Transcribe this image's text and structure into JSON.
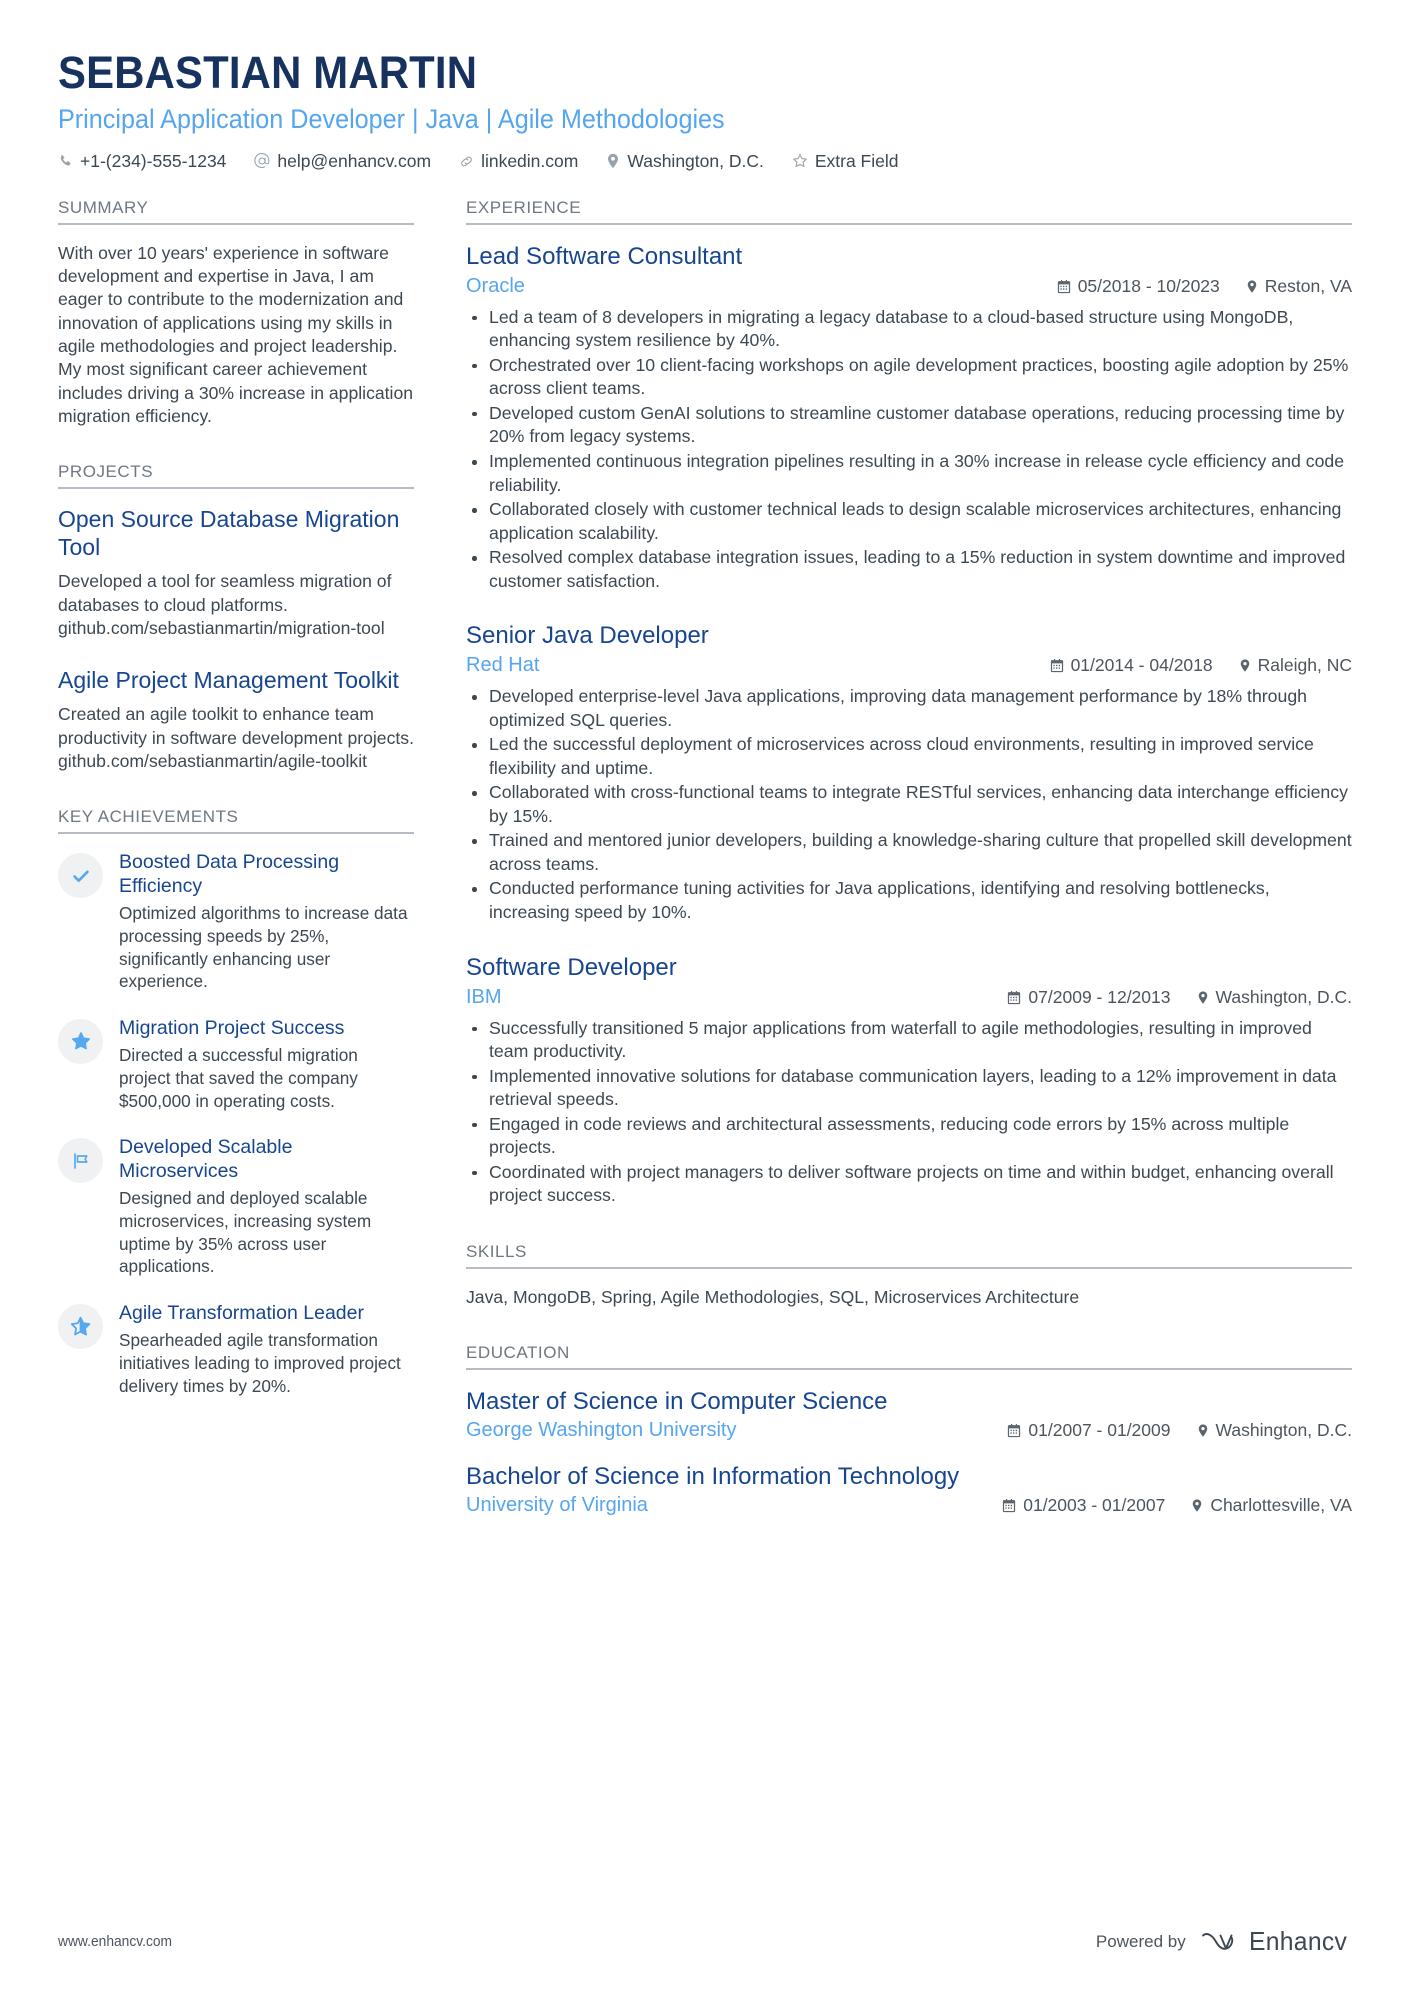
{
  "header": {
    "name": "SEBASTIAN MARTIN",
    "title": "Principal Application Developer | Java | Agile Methodologies",
    "contacts": [
      {
        "icon": "phone-icon",
        "text": "+1-(234)-555-1234"
      },
      {
        "icon": "at-icon",
        "text": "help@enhancv.com"
      },
      {
        "icon": "link-icon",
        "text": "linkedin.com"
      },
      {
        "icon": "location-pin-icon",
        "text": "Washington, D.C."
      },
      {
        "icon": "star-outline-icon",
        "text": "Extra Field"
      }
    ]
  },
  "sidebar": {
    "summary": {
      "heading": "SUMMARY",
      "text": "With over 10 years' experience in software development and expertise in Java, I am eager to contribute to the modernization and innovation of applications using my skills in agile methodologies and project leadership. My most significant career achievement includes driving a 30% increase in application migration efficiency."
    },
    "projects": {
      "heading": "PROJECTS",
      "items": [
        {
          "title": "Open Source Database Migration Tool",
          "description": "Developed a tool for seamless migration of databases to cloud platforms.\ngithub.com/sebastianmartin/migration-tool"
        },
        {
          "title": "Agile Project Management Toolkit",
          "description": "Created an agile toolkit to enhance team productivity in software development projects.\ngithub.com/sebastianmartin/agile-toolkit"
        }
      ]
    },
    "achievements": {
      "heading": "KEY ACHIEVEMENTS",
      "items": [
        {
          "icon": "check-icon",
          "title": "Boosted Data Processing Efficiency",
          "description": "Optimized algorithms to increase data processing speeds by 25%, significantly enhancing user experience."
        },
        {
          "icon": "star-filled-icon",
          "title": "Migration Project Success",
          "description": "Directed a successful migration project that saved the company $500,000 in operating costs."
        },
        {
          "icon": "flag-icon",
          "title": "Developed Scalable Microservices",
          "description": "Designed and deployed scalable microservices, increasing system uptime by 35% across user applications."
        },
        {
          "icon": "star-half-icon",
          "title": "Agile Transformation Leader",
          "description": "Spearheaded agile transformation initiatives leading to improved project delivery times by 20%."
        }
      ]
    }
  },
  "main": {
    "experience": {
      "heading": "EXPERIENCE",
      "jobs": [
        {
          "title": "Lead Software Consultant",
          "company": "Oracle",
          "dates": "05/2018 - 10/2023",
          "location": "Reston, VA",
          "bullets": [
            "Led a team of 8 developers in migrating a legacy database to a cloud-based structure using MongoDB, enhancing system resilience by 40%.",
            "Orchestrated over 10 client-facing workshops on agile development practices, boosting agile adoption by 25% across client teams.",
            "Developed custom GenAI solutions to streamline customer database operations, reducing processing time by 20% from legacy systems.",
            "Implemented continuous integration pipelines resulting in a 30% increase in release cycle efficiency and code reliability.",
            "Collaborated closely with customer technical leads to design scalable microservices architectures, enhancing application scalability.",
            "Resolved complex database integration issues, leading to a 15% reduction in system downtime and improved customer satisfaction."
          ]
        },
        {
          "title": "Senior Java Developer",
          "company": "Red Hat",
          "dates": "01/2014 - 04/2018",
          "location": "Raleigh, NC",
          "bullets": [
            "Developed enterprise-level Java applications, improving data management performance by 18% through optimized SQL queries.",
            "Led the successful deployment of microservices across cloud environments, resulting in improved service flexibility and uptime.",
            "Collaborated with cross-functional teams to integrate RESTful services, enhancing data interchange efficiency by 15%.",
            "Trained and mentored junior developers, building a knowledge-sharing culture that propelled skill development across teams.",
            "Conducted performance tuning activities for Java applications, identifying and resolving bottlenecks, increasing speed by 10%."
          ]
        },
        {
          "title": "Software Developer",
          "company": "IBM",
          "dates": "07/2009 - 12/2013",
          "location": "Washington, D.C.",
          "bullets": [
            "Successfully transitioned 5 major applications from waterfall to agile methodologies, resulting in improved team productivity.",
            "Implemented innovative solutions for database communication layers, leading to a 12% improvement in data retrieval speeds.",
            "Engaged in code reviews and architectural assessments, reducing code errors by 15% across multiple projects.",
            "Coordinated with project managers to deliver software projects on time and within budget, enhancing overall project success."
          ]
        }
      ]
    },
    "skills": {
      "heading": "SKILLS",
      "text": "Java, MongoDB, Spring, Agile Methodologies, SQL, Microservices Architecture"
    },
    "education": {
      "heading": "EDUCATION",
      "items": [
        {
          "degree": "Master of Science in Computer Science",
          "school": "George Washington University",
          "dates": "01/2007 - 01/2009",
          "location": "Washington, D.C."
        },
        {
          "degree": "Bachelor of Science in Information Technology",
          "school": "University of Virginia",
          "dates": "01/2003 - 01/2007",
          "location": "Charlottesville, VA"
        }
      ]
    }
  },
  "footer": {
    "url": "www.enhancv.com",
    "powered_by": "Powered by",
    "brand": "Enhancv"
  },
  "colors": {
    "name_navy": "#17325e",
    "heading_navy": "#17458f",
    "accent_blue": "#55a5ef",
    "body_gray": "#3d4852",
    "rule_gray": "#b6bcc4"
  }
}
